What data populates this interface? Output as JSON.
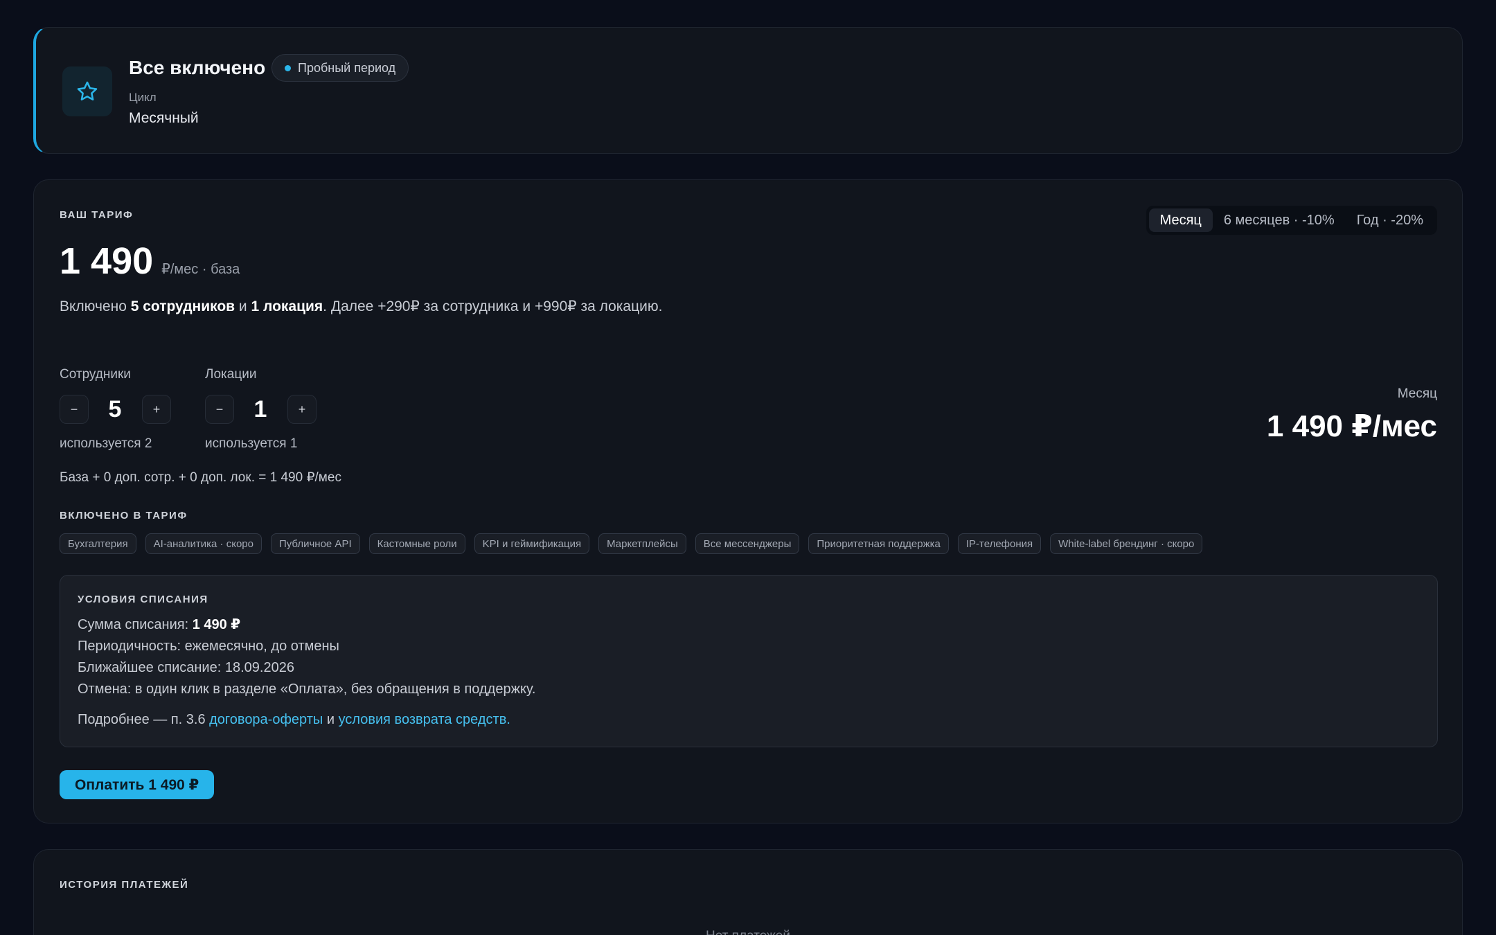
{
  "plan": {
    "title": "Все включено",
    "badge": "Пробный период",
    "cycle_label": "Цикл",
    "cycle_value": "Месячный",
    "icon": "star-icon"
  },
  "tariff": {
    "section_label": "ВАШ ТАРИФ",
    "price": "1 490",
    "price_suffix": "₽/мес · база",
    "included": {
      "prefix": "Включено ",
      "employees": "5 сотрудников",
      "and": " и ",
      "locations": "1 локация",
      "suffix": ". Далее +290₽ за сотрудника и +990₽ за локацию."
    },
    "periods": [
      {
        "label": "Месяц",
        "active": true
      },
      {
        "label": "6 месяцев · -10%",
        "active": false
      },
      {
        "label": "Год · -20%",
        "active": false
      }
    ],
    "employees": {
      "label": "Сотрудники",
      "value": "5",
      "used": "используется 2",
      "minus": "−",
      "plus": "+"
    },
    "locations": {
      "label": "Локации",
      "value": "1",
      "used": "используется 1",
      "minus": "−",
      "plus": "+"
    },
    "summary": {
      "period": "Месяц",
      "total": "1 490 ₽/мес"
    },
    "formula": "База + 0 доп. сотр. + 0 доп. лок. = 1 490 ₽/мес",
    "features_label": "ВКЛЮЧЕНО В ТАРИФ",
    "features": [
      "Бухгалтерия",
      "AI-аналитика · скоро",
      "Публичное API",
      "Кастомные роли",
      "KPI и геймификация",
      "Маркетплейсы",
      "Все мессенджеры",
      "Приоритетная поддержка",
      "IP-телефония",
      "White-label брендинг · скоро"
    ],
    "conditions": {
      "label": "УСЛОВИЯ СПИСАНИЯ",
      "amount_label": "Сумма списания: ",
      "amount_value": "1 490 ₽",
      "periodicity": "Периодичность: ежемесячно, до отмены",
      "next_charge": "Ближайшее списание: 18.09.2026",
      "cancel": "Отмена: в один клик в разделе «Оплата», без обращения в поддержку.",
      "more_prefix": "Подробнее — п. 3.6 ",
      "offer_link": "договора-оферты",
      "more_and": " и ",
      "refund_link": "условия возврата средств."
    },
    "pay_button": "Оплатить 1 490 ₽"
  },
  "history": {
    "section_label": "ИСТОРИЯ ПЛАТЕЖЕЙ",
    "empty": "Нет платежей"
  },
  "colors": {
    "accent": "#27b4ea",
    "background": "#0a0e1a",
    "card": "#11151d"
  }
}
